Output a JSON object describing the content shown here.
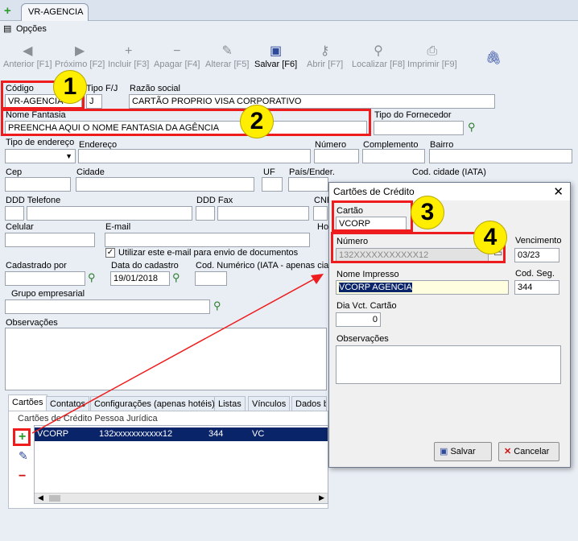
{
  "window": {
    "tab_label": "VR-AGENCIA",
    "options_label": "Opções"
  },
  "toolbar": {
    "prev": "Anterior [F1]",
    "next": "Próximo [F2]",
    "add": "Incluir [F3]",
    "delete": "Apagar [F4]",
    "edit": "Alterar [F5]",
    "save": "Salvar [F6]",
    "open": "Abrir [F7]",
    "locate": "Localizar [F8]",
    "print": "Imprimir [F9]"
  },
  "form": {
    "codigo_label": "Código",
    "codigo_value": "VR-AGENCIA",
    "tipo_fj_label": "Tipo F/J",
    "tipo_fj_value": "J",
    "razao_label": "Razão social",
    "razao_value": "CARTÃO PROPRIO VISA CORPORATIVO",
    "fantasia_label": "Nome Fantasia",
    "fantasia_value": "PREENCHA AQUI O NOME FANTASIA DA AGÊNCIA",
    "tipo_fornecedor_label": "Tipo do Fornecedor",
    "tipo_endereco_label": "Tipo de endereço",
    "endereco_label": "Endereço",
    "numero_label": "Número",
    "complemento_label": "Complemento",
    "bairro_label": "Bairro",
    "cep_label": "Cep",
    "cidade_label": "Cidade",
    "uf_label": "UF",
    "pais_label": "País/Ender.",
    "cod_cidade_label": "Cod. cidade (IATA)",
    "ddd_tel_label": "DDD Telefone",
    "ddd_fax_label": "DDD Fax",
    "cnpj_label": "CNP",
    "celular_label": "Celular",
    "email_label": "E-mail",
    "ho_label": "Ho",
    "email_docs_label": "Utilizar este e-mail para envio de documentos",
    "cadastrado_label": "Cadastrado por",
    "data_cadastro_label": "Data do cadastro",
    "data_cadastro_value": "19/01/2018",
    "cod_numerico_label": "Cod. Numérico (IATA - apenas cias",
    "grupo_label": "Grupo empresarial",
    "observacoes_label": "Observações"
  },
  "tabs": [
    "Cartões",
    "Contatos",
    "Configurações (apenas hotéis)",
    "Listas",
    "Vínculos",
    "Dados b"
  ],
  "cards_panel": {
    "title": "Cartões de Crédito Pessoa Jurídica",
    "row": {
      "cartao": "VCORP",
      "numero": "132xxxxxxxxxxx12",
      "cod": "344",
      "extra": "VC"
    }
  },
  "dialog": {
    "title": "Cartões de Crédito",
    "cartao_label": "Cartão",
    "cartao_value": "VCORP",
    "numero_label": "Número",
    "numero_value": "132XXXXXXXXXXX12",
    "vencimento_label": "Vencimento",
    "vencimento_value": "03/23",
    "nome_impresso_label": "Nome Impresso",
    "nome_impresso_value": "VCORP AGENCIA",
    "cod_seg_label": "Cod. Seg.",
    "cod_seg_value": "344",
    "dia_vct_label": "Dia Vct. Cartão",
    "dia_vct_value": "0",
    "observacoes_label": "Observações",
    "save_label": "Salvar",
    "cancel_label": "Cancelar"
  },
  "badges": [
    "1",
    "2",
    "3",
    "4"
  ],
  "colors": {
    "highlight": "#ee1c1c",
    "badge": "#ffee00",
    "selected_row": "#0a246a",
    "nome_impresso_bg": "#ffffe0"
  }
}
